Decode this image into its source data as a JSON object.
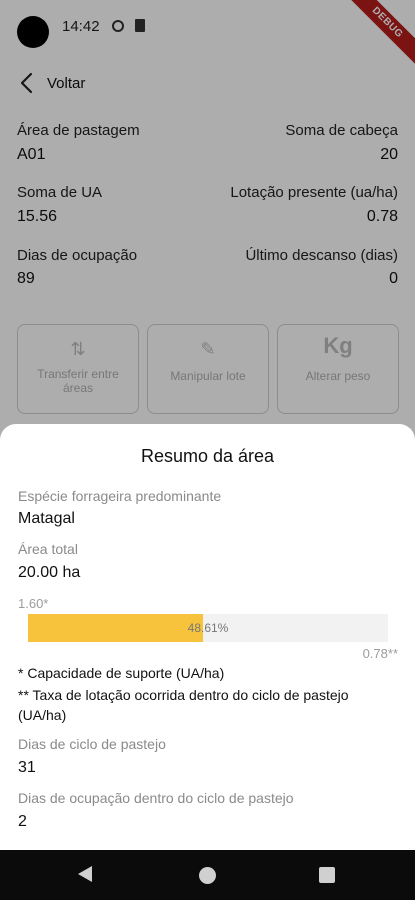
{
  "status_bar": {
    "time": "14:42",
    "debug_label": "DEBUG"
  },
  "topbar": {
    "back_label": "Voltar"
  },
  "details": {
    "area_label": "Área de pastagem",
    "area_value": "A01",
    "heads_label": "Soma de cabeça",
    "heads_value": "20",
    "ua_label": "Soma de UA",
    "ua_value": "15.56",
    "lotacao_label": "Lotação presente (ua/ha)",
    "lotacao_value": "0.78",
    "dias_label": "Dias de ocupação",
    "dias_value": "89",
    "descanso_label": "Último descanso (dias)",
    "descanso_value": "0"
  },
  "actions": [
    {
      "label": "Transferir entre áreas",
      "icon": "transfer-icon"
    },
    {
      "label": "Manipular lote",
      "icon": "pencil-icon"
    },
    {
      "label": "Alterar peso",
      "icon": "Kg"
    }
  ],
  "sheet": {
    "title": "Resumo da área",
    "especie_label": "Espécie forrageira predominante",
    "especie_value": "Matagal",
    "area_total_label": "Área total",
    "area_total_value": "20.00 ha",
    "bar_top": "1.60*",
    "bar_percent_text": "48.61%",
    "bar_percent_value": 48.61,
    "bar_bottom": "0.78**",
    "note1": "* Capacidade de suporte (UA/ha)",
    "note2": "** Taxa de lotação ocorrida dentro do ciclo de pastejo (UA/ha)",
    "ciclo_label": "Dias de ciclo de pastejo",
    "ciclo_value": "31",
    "ocupacao_label": "Dias de ocupação dentro do ciclo de pastejo",
    "ocupacao_value": "2"
  },
  "colors": {
    "bar_fill": "#f7c23c",
    "scrim": "rgba(0,0,0,0.32)",
    "debug": "#b71c1c"
  }
}
